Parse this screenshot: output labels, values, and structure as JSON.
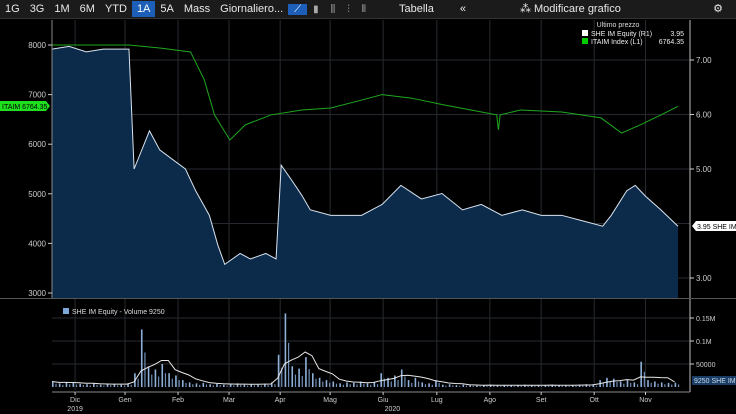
{
  "toolbar": {
    "ranges": [
      "1G",
      "3G",
      "1M",
      "6M",
      "YTD",
      "1A",
      "5A",
      "Mass"
    ],
    "active_range": "1A",
    "frequency": "Giornaliero...",
    "chart_icons": [
      "line-chart-icon",
      "bar-chart-icon",
      "candle-chart-icon",
      "ohlc-icon",
      "hilo-icon"
    ],
    "table_label": "Tabella",
    "collapse_label": "«",
    "modify_label": "Modificare grafico",
    "settings_icon": "gear-icon",
    "active_color": "#1d5fb8"
  },
  "chart_data": {
    "type": "line",
    "xunit": "days since 2019-11-20",
    "legend": {
      "title": "Ultimo prezzo",
      "placement": "top-right",
      "entries": [
        {
          "name": "SHE IM Equity  (R1)",
          "value": "3.95",
          "color": "#ffffff"
        },
        {
          "name": "ITAIM Index  (L1)",
          "value": "6764.35",
          "color": "#00cc00"
        }
      ]
    },
    "series": [
      {
        "name": "SHE IM Equity",
        "axis": "right",
        "color": "#d8e4f0",
        "fill": "#0c2a4a",
        "points": [
          [
            0,
            7.2
          ],
          [
            10,
            7.25
          ],
          [
            20,
            7.15
          ],
          [
            30,
            7.2
          ],
          [
            45,
            7.2
          ],
          [
            48,
            5.0
          ],
          [
            57,
            5.7
          ],
          [
            63,
            5.35
          ],
          [
            78,
            5.0
          ],
          [
            84,
            4.6
          ],
          [
            92,
            4.15
          ],
          [
            97,
            3.6
          ],
          [
            101,
            3.25
          ],
          [
            110,
            3.45
          ],
          [
            116,
            3.35
          ],
          [
            125,
            3.45
          ],
          [
            131,
            3.35
          ],
          [
            134,
            5.07
          ],
          [
            140,
            4.8
          ],
          [
            146,
            4.52
          ],
          [
            151,
            4.25
          ],
          [
            163,
            4.15
          ],
          [
            181,
            4.15
          ],
          [
            193,
            4.35
          ],
          [
            204,
            4.7
          ],
          [
            216,
            4.45
          ],
          [
            228,
            4.55
          ],
          [
            240,
            4.25
          ],
          [
            251,
            4.35
          ],
          [
            263,
            4.15
          ],
          [
            275,
            4.25
          ],
          [
            286,
            4.15
          ],
          [
            298,
            4.15
          ],
          [
            310,
            4.05
          ],
          [
            322,
            3.95
          ],
          [
            327,
            4.15
          ],
          [
            336,
            4.6
          ],
          [
            341,
            4.7
          ],
          [
            347,
            4.5
          ],
          [
            356,
            4.25
          ],
          [
            366,
            3.95
          ]
        ]
      },
      {
        "name": "ITAIM Index",
        "axis": "left",
        "color": "#1fa81f",
        "points": [
          [
            0,
            8000
          ],
          [
            45,
            8000
          ],
          [
            63,
            7940
          ],
          [
            81,
            7860
          ],
          [
            89,
            7300
          ],
          [
            95,
            6590
          ],
          [
            104,
            6085
          ],
          [
            113,
            6390
          ],
          [
            128,
            6590
          ],
          [
            146,
            6690
          ],
          [
            163,
            6730
          ],
          [
            181,
            6890
          ],
          [
            193,
            7000
          ],
          [
            210,
            6930
          ],
          [
            228,
            6800
          ],
          [
            245,
            6690
          ],
          [
            260,
            6590
          ],
          [
            261,
            6290
          ],
          [
            262,
            6590
          ],
          [
            274,
            6690
          ],
          [
            298,
            6650
          ],
          [
            321,
            6530
          ],
          [
            333,
            6225
          ],
          [
            344,
            6390
          ],
          [
            356,
            6590
          ],
          [
            366,
            6764.35
          ]
        ]
      }
    ],
    "left_axis": {
      "ticks": [
        3000,
        4000,
        5000,
        6000,
        7000,
        8000
      ],
      "range": [
        2900,
        8300
      ]
    },
    "right_axis": {
      "ticks": [
        3,
        5,
        6,
        7
      ],
      "labels": [
        "3.00",
        "5.00",
        "6.00",
        "7.00"
      ],
      "range": [
        2.7,
        7.7
      ]
    },
    "left_badge": "ITAIM 6764.35",
    "right_badge": "3.95 SHE IM",
    "volume": {
      "title": "SHE IM Equity - Volume 9250",
      "badge": "9250 SHE IM",
      "step_days": 4,
      "values": [
        12000,
        8000,
        10000,
        9000,
        7000,
        6000,
        8000,
        5000,
        7000,
        6000,
        5000,
        8000,
        30000,
        125000,
        45000,
        38000,
        50000,
        30000,
        25000,
        15000,
        10000,
        8000,
        9000,
        6000,
        7000,
        5000,
        6000,
        8000,
        5000,
        6000,
        5000,
        7000,
        10000,
        70000,
        160000,
        45000,
        40000,
        65000,
        30000,
        20000,
        15000,
        12000,
        8000,
        10000,
        9000,
        12000,
        8000,
        10000,
        30000,
        20000,
        25000,
        38000,
        15000,
        20000,
        10000,
        8000,
        15000,
        5000,
        6000,
        4000,
        5000,
        4000,
        3000,
        4000,
        5000,
        3000,
        4000,
        3000,
        4000,
        5000,
        4000,
        3000,
        4000,
        5000,
        4000,
        3000,
        4000,
        5000,
        6000,
        5000,
        15000,
        20000,
        18000,
        12000,
        15000,
        10000,
        55000,
        15000,
        12000,
        10000,
        9000,
        9250
      ],
      "ticks": [
        50000,
        100000,
        150000
      ],
      "tick_labels": [
        "50000",
        "0.1M",
        "0.15M"
      ]
    },
    "months": [
      {
        "label": "Dic",
        "day": 13.5
      },
      {
        "label": "Gen",
        "day": 42.7
      },
      {
        "label": "Feb",
        "day": 73.7
      },
      {
        "label": "Mar",
        "day": 103.5
      },
      {
        "label": "Apr",
        "day": 133.4
      },
      {
        "label": "Mag",
        "day": 162.6
      },
      {
        "label": "Giu",
        "day": 193.6
      },
      {
        "label": "Lug",
        "day": 225
      },
      {
        "label": "Ago",
        "day": 256
      },
      {
        "label": "Set",
        "day": 286
      },
      {
        "label": "Ott",
        "day": 317
      },
      {
        "label": "Nov",
        "day": 347
      }
    ],
    "years": [
      {
        "label": "2019",
        "day": 13.5
      },
      {
        "label": "2020",
        "day": 199
      }
    ]
  }
}
